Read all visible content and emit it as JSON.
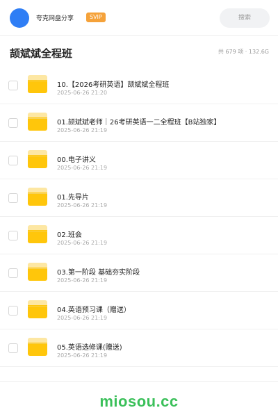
{
  "topbar": {
    "app_name": "夸克网盘分享",
    "badge": "SVIP",
    "search_placeholder": "搜索"
  },
  "header": {
    "title": "颉斌斌全程班",
    "stats": "共 679 项 · 132.6G"
  },
  "files": [
    {
      "name": "10.【2026考研英语】颉斌斌全程班",
      "date": "2025-06-26 21:20"
    },
    {
      "name": "01.颉斌斌老师｜26考研英语一二全程班【B站独家】",
      "date": "2025-06-26 21:19"
    },
    {
      "name": "00.电子讲义",
      "date": "2025-06-26 21:19"
    },
    {
      "name": "01.先导片",
      "date": "2025-06-26 21:19"
    },
    {
      "name": "02.班会",
      "date": "2025-06-26 21:19"
    },
    {
      "name": "03.第一阶段 基础夯实阶段",
      "date": "2025-06-26 21:19"
    },
    {
      "name": "04.英语预习课（赠送）",
      "date": "2025-06-26 21:19"
    },
    {
      "name": "05.英语选修课(赠送)",
      "date": "2025-06-26 21:19"
    }
  ],
  "footer": {
    "watermark": "miosou.cc"
  },
  "colors": {
    "avatar": "#2f7ef5",
    "badge": "#f5a23a",
    "folder": "#ffc60b",
    "watermark": "#3bc05a"
  },
  "icons": [
    "avatar",
    "folder-icon",
    "checkbox-icon"
  ]
}
